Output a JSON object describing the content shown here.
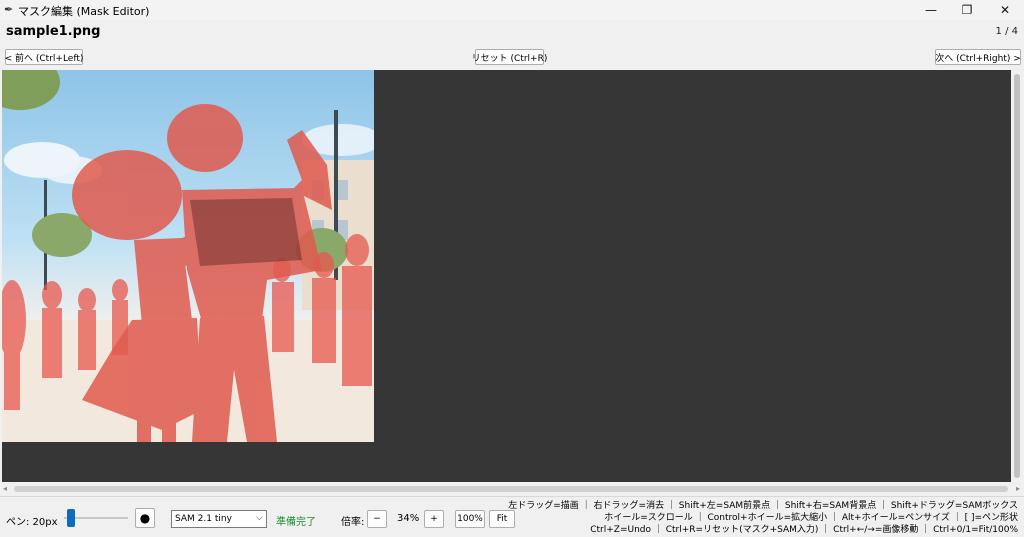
{
  "window": {
    "title": "マスク編集 (Mask Editor)",
    "app_icon": "feather-icon",
    "minimize_glyph": "—",
    "maximize_glyph": "❐",
    "close_glyph": "✕"
  },
  "header": {
    "file_name": "sample1.png",
    "page_count": "1 / 4"
  },
  "nav": {
    "prev_label": "< 前へ (Ctrl+Left)",
    "reset_label": "リセット (Ctrl+R)",
    "next_label": "次へ (Ctrl+Right) >"
  },
  "scrollbars": {
    "left_arrow": "◂",
    "right_arrow": "▸"
  },
  "toolbar": {
    "pen_size_label": "ペン: 20px",
    "pen_shape_glyph": "●",
    "model_selected": "SAM 2.1 tiny",
    "model_chevron": "⌵",
    "status_text": "準備完了",
    "zoom_label": "倍率:",
    "zoom_minus": "−",
    "zoom_value": "34%",
    "zoom_plus": "+",
    "zoom_100": "100%",
    "zoom_fit": "Fit"
  },
  "hints": {
    "line1": "左ドラッグ=描画 ｜ 右ドラッグ=消去 ｜ Shift+左=SAM前景点 ｜ Shift+右=SAM背景点 ｜ Shift+ドラッグ=SAMボックス",
    "line2": "ホイール=スクロール ｜ Control+ホイール=拡大縮小 ｜ Alt+ホイール=ペンサイズ ｜ [ ]=ペン形状",
    "line3": "Ctrl+Z=Undo ｜ Ctrl+R=リセット(マスク+SAM入力) ｜ Ctrl+←/→=画像移動 ｜ Ctrl+0/1=Fit/100%"
  },
  "colors": {
    "canvas_bg": "#363636",
    "mask_overlay": "#e8584f",
    "status_green": "#1a8f2a",
    "accent_blue": "#0f6cbd"
  }
}
